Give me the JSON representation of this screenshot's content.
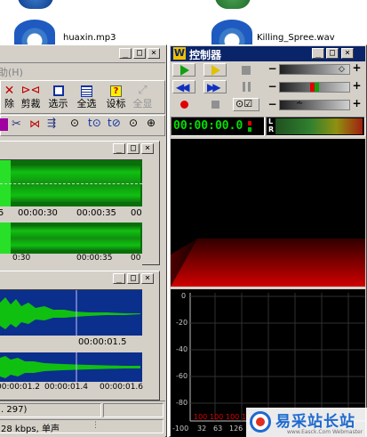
{
  "desktop": {
    "icon1_label": "huaxin.mp3",
    "icon2_label": "Killing_Spree.wav"
  },
  "editor": {
    "menu_help": "助(H)",
    "toolbar": [
      {
        "label": "除",
        "icon": "delete-icon"
      },
      {
        "label": "剪裁",
        "icon": "crop-icon"
      },
      {
        "label": "选示",
        "icon": "view-selection-icon"
      },
      {
        "label": "全选",
        "icon": "select-all-icon"
      },
      {
        "label": "设标",
        "icon": "set-marker-icon"
      },
      {
        "label": "全显",
        "icon": "show-all-icon"
      }
    ],
    "wave1_ticks": [
      "5",
      "00:00:30",
      "00:00:35",
      "00"
    ],
    "wave1_ticks2": [
      "0:30",
      "00:00:35",
      "00"
    ],
    "wave2_ticks": [
      "00:00:01.5"
    ],
    "wave2_ticks2": [
      "00:00:01.2",
      "00:00:01.4",
      "00:00:01.6"
    ],
    "status_left": ". 297)",
    "status_right": "28 kbps, 单声"
  },
  "controller": {
    "title": "控制器",
    "time": "00:00:00.0",
    "meter_letters": [
      "L",
      "R"
    ],
    "spectrum_db_labels": [
      "0",
      "-20",
      "-40",
      "-60",
      "-80"
    ],
    "spectrum_x_labels": [
      "-100",
      "32",
      "63",
      "126",
      "2"
    ],
    "spectrum_red_labels": [
      "100",
      "100",
      "100",
      "100",
      "100"
    ]
  },
  "watermark": {
    "text": "易采站长站",
    "subtext": "www.Easck.Com Webmaster"
  },
  "colors": {
    "titlebar": "#d4d0c8",
    "controller_title": "#0a246a",
    "wave_green": "#10a010",
    "wave_blue": "#0b2f8c",
    "time_green": "#00e000"
  }
}
